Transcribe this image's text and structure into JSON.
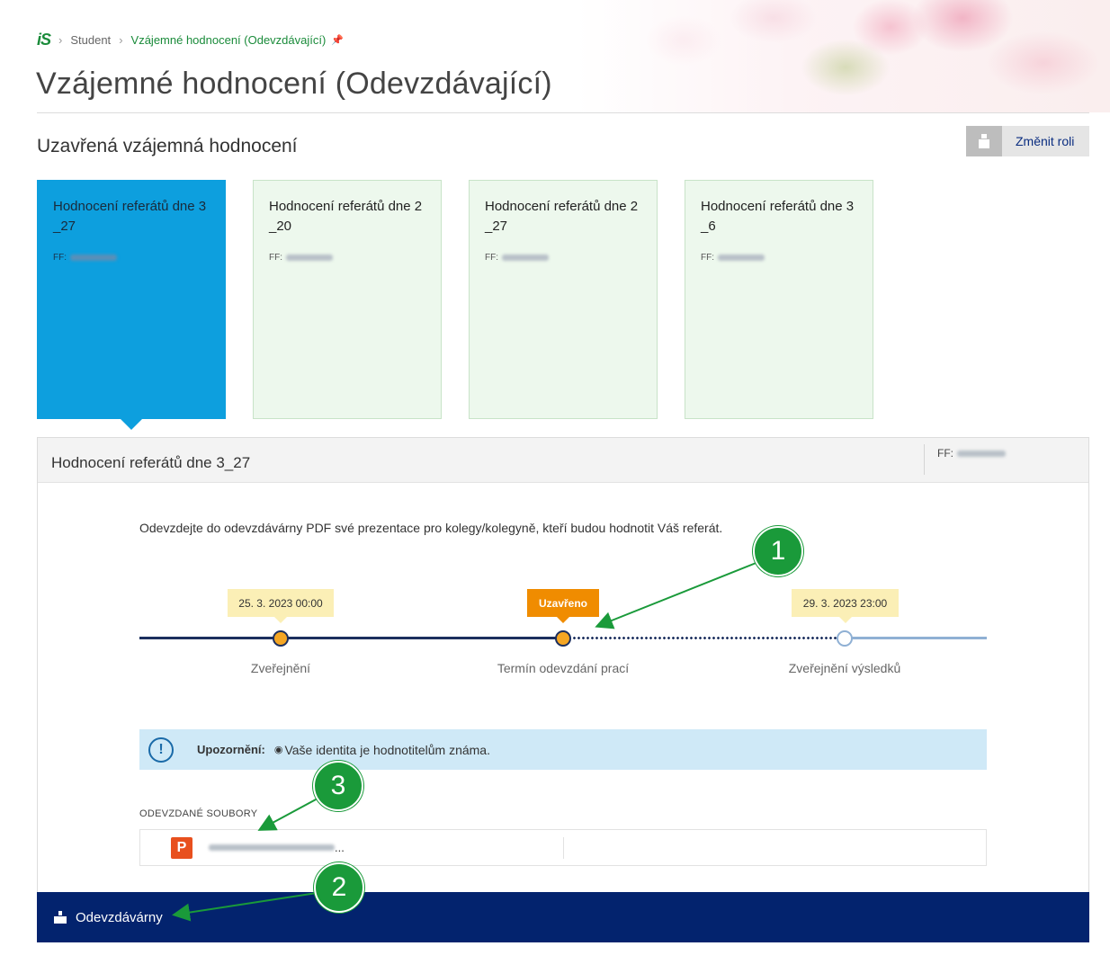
{
  "breadcrumb": {
    "logo": "iS",
    "items": [
      "Student",
      "Vzájemné hodnocení (Odevzdávající)"
    ],
    "pin_icon": "pin-icon"
  },
  "page_title": "Vzájemné hodnocení (Odevzdávající)",
  "section_title": "Uzavřená vzájemná hodnocení",
  "role_button": {
    "label": "Změnit roli",
    "icon": "person-icon"
  },
  "cards": [
    {
      "title": "Hodnocení referátů dne 3_27",
      "meta_prefix": "FF:",
      "active": true
    },
    {
      "title": "Hodnocení referátů dne 2_20",
      "meta_prefix": "FF:",
      "active": false
    },
    {
      "title": "Hodnocení referátů dne 2_27",
      "meta_prefix": "FF:",
      "active": false
    },
    {
      "title": "Hodnocení referátů dne 3_6",
      "meta_prefix": "FF:",
      "active": false
    }
  ],
  "panel": {
    "title": "Hodnocení referátů dne 3_27",
    "meta_prefix": "FF:",
    "instruction": "Odevzdejte do odevzdávárny PDF své prezentace pro kolegy/kolegyně, kteří budou hodnotit Váš referát.",
    "timeline": [
      {
        "date": "25. 3. 2023 00:00",
        "label": "Zveřejnění",
        "state": "done"
      },
      {
        "date": "Uzavřeno",
        "label": "Termín odevzdání prací",
        "state": "closed"
      },
      {
        "date": "29. 3. 2023 23:00",
        "label": "Zveřejnění výsledků",
        "state": "future"
      }
    ],
    "notice": {
      "label": "Upozornění:",
      "text": "Vaše identita je hodnotitelům známa.",
      "icon": "info-icon",
      "eye_icon": "eye-icon"
    },
    "files_heading": "ODEVZDANÉ SOUBORY",
    "files": [
      {
        "icon": "powerpoint-file-icon",
        "icon_letter": "P",
        "name_suffix": "..."
      }
    ],
    "bottom_button": {
      "label": "Odevzdávárny",
      "icon": "upload-box-icon"
    }
  },
  "annotations": [
    "1",
    "2",
    "3"
  ],
  "colors": {
    "active_card": "#0d9fde",
    "card_bg": "#edf8ed",
    "timeline_dark": "#1c2f5e",
    "dot_orange": "#f5a623",
    "closed_badge": "#f08c00",
    "date_badge": "#fbefb6",
    "notice_bg": "#cfe9f7",
    "bottom_bar": "#03236e",
    "annotation_green": "#1a9a3a"
  }
}
